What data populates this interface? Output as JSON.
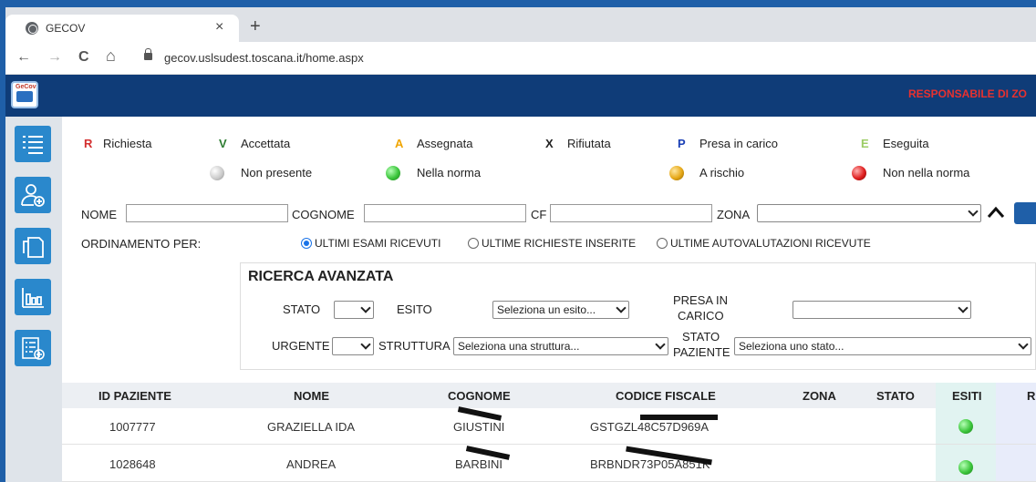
{
  "browser": {
    "tab_title": "GECOV",
    "tab_close": "×",
    "new_tab": "+",
    "url": "gecov.uslsudest.toscana.it/home.aspx",
    "nav": {
      "back": "←",
      "forward": "→",
      "reload": "C",
      "home": "⌂"
    }
  },
  "header": {
    "logo_text": "GeCov",
    "role": "RESPONSABILE DI ZO"
  },
  "sidebar": {
    "items": [
      {
        "icon": "list-icon"
      },
      {
        "icon": "add-user-icon"
      },
      {
        "icon": "documents-icon"
      },
      {
        "icon": "bar-chart-icon"
      },
      {
        "icon": "checklist-add-icon"
      }
    ]
  },
  "legend": {
    "status": [
      {
        "code": "R",
        "label": "Richiesta",
        "color": "#d32f2f"
      },
      {
        "code": "V",
        "label": "Accettata",
        "color": "#2e7d32"
      },
      {
        "code": "A",
        "label": "Assegnata",
        "color": "#f0a500"
      },
      {
        "code": "X",
        "label": "Rifiutata",
        "color": "#222222"
      },
      {
        "code": "P",
        "label": "Presa in carico",
        "color": "#1a3fb5"
      },
      {
        "code": "E",
        "label": "Eseguita",
        "color": "#9ccc65"
      }
    ],
    "results": [
      {
        "label": "Non presente",
        "color": "#c8c8c8"
      },
      {
        "label": "Nella norma",
        "color": "#3cc63c"
      },
      {
        "label": "A rischio",
        "color": "#e6a817"
      },
      {
        "label": "Non nella norma",
        "color": "#e02020"
      }
    ]
  },
  "filters": {
    "nome_label": "NOME",
    "cognome_label": "COGNOME",
    "cf_label": "CF",
    "zona_label": "ZONA",
    "ordinamento_label": "ORDINAMENTO PER:",
    "sort_options": [
      {
        "label": "ULTIMI ESAMI RICEVUTI",
        "checked": true
      },
      {
        "label": "ULTIME RICHIESTE INSERITE",
        "checked": false
      },
      {
        "label": "ULTIME AUTOVALUTAZIONI RICEVUTE",
        "checked": false
      }
    ]
  },
  "advanced": {
    "title": "RICERCA AVANZATA",
    "stato_label": "STATO",
    "esito_label": "ESITO",
    "esito_value": "Seleziona un esito...",
    "presa_label_1": "PRESA IN",
    "presa_label_2": "CARICO",
    "urgente_label": "URGENTE",
    "struttura_label": "STRUTTURA",
    "struttura_value": "Seleziona una struttura...",
    "stato_paziente_label_1": "STATO",
    "stato_paziente_label_2": "PAZIENTE",
    "stato_paziente_value": "Seleziona uno stato..."
  },
  "table": {
    "columns": [
      "ID PAZIENTE",
      "NOME",
      "COGNOME",
      "CODICE FISCALE",
      "ZONA",
      "STATO",
      "ESITI",
      "R"
    ],
    "rows": [
      {
        "id": "1007777",
        "nome": "GRAZIELLA IDA",
        "cognome": "GIUSTINI",
        "cf": "GSTGZL48C57D969A",
        "zona": "",
        "stato": "",
        "esito_color": "#3cc63c"
      },
      {
        "id": "1028648",
        "nome": "ANDREA",
        "cognome": "BARBINI",
        "cf": "BRBNDR73P05A851K",
        "zona": "",
        "stato": "",
        "esito_color": "#3cc63c"
      }
    ]
  }
}
